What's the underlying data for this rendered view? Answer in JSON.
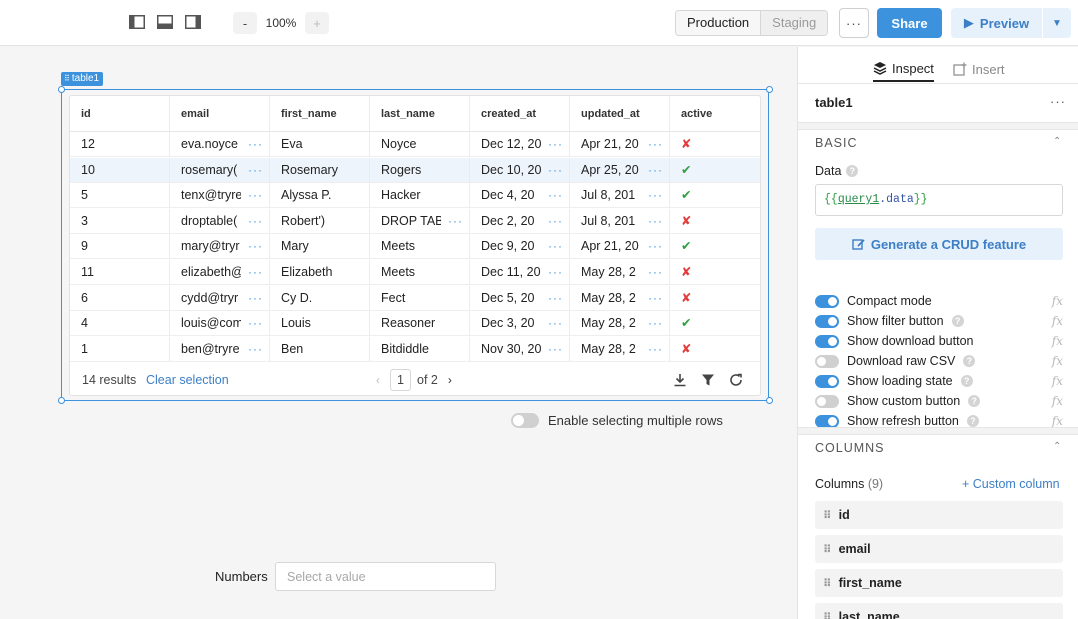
{
  "toolbar": {
    "zoom_out": "-",
    "zoom_level": "100%",
    "zoom_in": "+",
    "env_production": "Production",
    "env_staging": "Staging",
    "more": "···",
    "share": "Share",
    "preview": "Preview"
  },
  "canvas": {
    "component_tag": "table1",
    "table": {
      "columns": [
        "id",
        "email",
        "first_name",
        "last_name",
        "created_at",
        "updated_at",
        "active"
      ],
      "rows": [
        {
          "id": "12",
          "email": "eva.noyce",
          "first_name": "Eva",
          "last_name": "Noyce",
          "created_at": "Dec 12, 20",
          "updated_at": "Apr 21, 20",
          "active": "✘"
        },
        {
          "id": "10",
          "email": "rosemary(",
          "first_name": "Rosemary",
          "last_name": "Rogers",
          "created_at": "Dec 10, 20",
          "updated_at": "Apr 25, 20",
          "active": "✔"
        },
        {
          "id": "5",
          "email": "tenx@tryre",
          "first_name": "Alyssa P.",
          "last_name": "Hacker",
          "created_at": "Dec 4, 20",
          "updated_at": "Jul 8, 201",
          "active": "✔"
        },
        {
          "id": "3",
          "email": "droptable(",
          "first_name": "Robert')",
          "last_name": "DROP TAB",
          "created_at": "Dec 2, 20",
          "updated_at": "Jul 8, 201",
          "active": "✘"
        },
        {
          "id": "9",
          "email": "mary@tryr",
          "first_name": "Mary",
          "last_name": "Meets",
          "created_at": "Dec 9, 20",
          "updated_at": "Apr 21, 20",
          "active": "✔"
        },
        {
          "id": "11",
          "email": "elizabeth@",
          "first_name": "Elizabeth",
          "last_name": "Meets",
          "created_at": "Dec 11, 20",
          "updated_at": "May 28, 2",
          "active": "✘"
        },
        {
          "id": "6",
          "email": "cydd@tryr",
          "first_name": "Cy D.",
          "last_name": "Fect",
          "created_at": "Dec 5, 20",
          "updated_at": "May 28, 2",
          "active": "✘"
        },
        {
          "id": "4",
          "email": "louis@com",
          "first_name": "Louis",
          "last_name": "Reasoner",
          "created_at": "Dec 3, 20",
          "updated_at": "May 28, 2",
          "active": "✔"
        },
        {
          "id": "1",
          "email": "ben@tryre",
          "first_name": "Ben",
          "last_name": "Bitdiddle",
          "created_at": "Nov 30, 20",
          "updated_at": "May 28, 2",
          "active": "✘"
        }
      ],
      "results": "14 results",
      "clear_selection": "Clear selection",
      "page_current": "1",
      "page_total": "of 2"
    },
    "multi_select_label": "Enable selecting multiple rows",
    "numbers_label": "Numbers",
    "numbers_placeholder": "Select a value"
  },
  "inspector": {
    "tab_inspect": "Inspect",
    "tab_insert": "Insert",
    "component_name": "table1",
    "basic_title": "BASIC",
    "data_label": "Data",
    "data_value": {
      "open": "{{",
      "query": "query1",
      "dot": ".",
      "field": "data",
      "close": "}}"
    },
    "crud_button": "Generate a CRUD feature",
    "options": [
      {
        "label": "Compact mode",
        "on": true,
        "help": false
      },
      {
        "label": "Show filter button",
        "on": true,
        "help": true
      },
      {
        "label": "Show download button",
        "on": true,
        "help": false
      },
      {
        "label": "Download raw CSV",
        "on": false,
        "help": true
      },
      {
        "label": "Show loading state",
        "on": true,
        "help": true
      },
      {
        "label": "Show custom button",
        "on": false,
        "help": true
      },
      {
        "label": "Show refresh button",
        "on": true,
        "help": true
      }
    ],
    "fx": "fx",
    "columns_title": "COLUMNS",
    "columns_label": "Columns",
    "columns_count": "(9)",
    "custom_column": "+ Custom column",
    "column_items": [
      "id",
      "email",
      "first_name",
      "last_name"
    ]
  }
}
